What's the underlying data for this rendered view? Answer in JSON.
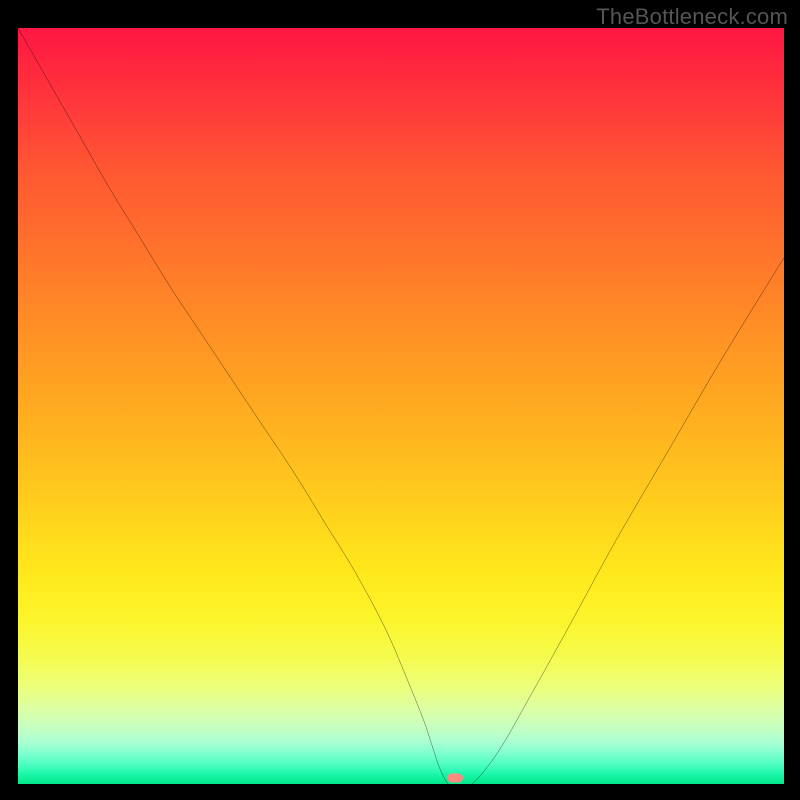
{
  "watermark": "TheBottleneck.com",
  "colors": {
    "background": "#000000",
    "curve": "#000000",
    "marker": "#ff8a80",
    "watermark": "#555555"
  },
  "chart_data": {
    "type": "line",
    "title": "",
    "xlabel": "",
    "ylabel": "",
    "xlim": [
      0,
      100
    ],
    "ylim": [
      0,
      100
    ],
    "grid": false,
    "series": [
      {
        "name": "bottleneck-curve",
        "x": [
          0,
          4,
          8,
          12,
          16,
          20,
          24,
          28,
          32,
          36,
          40,
          44,
          48,
          51,
          53,
          54,
          55,
          56,
          57,
          58,
          60,
          63,
          67,
          72,
          78,
          85,
          92,
          100
        ],
        "values": [
          100,
          93,
          86,
          79,
          72.5,
          66,
          60,
          54,
          48,
          42,
          35.5,
          29,
          21.5,
          14.5,
          9.5,
          6.5,
          3.5,
          1.5,
          0.5,
          0.5,
          2,
          6,
          13,
          22,
          33,
          45,
          57,
          70
        ]
      }
    ],
    "annotations": [
      {
        "name": "min-marker",
        "x": 57,
        "y": 0.8
      }
    ]
  }
}
